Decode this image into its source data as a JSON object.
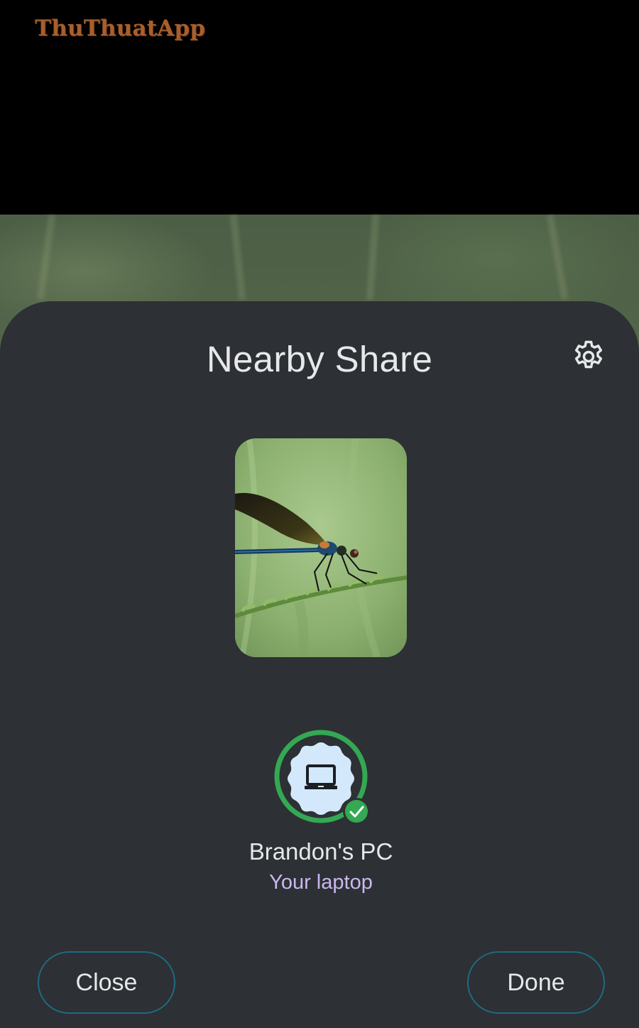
{
  "watermark": {
    "text": "ThuThuatApp"
  },
  "sheet": {
    "title": "Nearby Share",
    "settings_icon": "gear-icon"
  },
  "preview": {
    "image": "dragonfly-on-grass-photo"
  },
  "device": {
    "icon": "laptop-icon",
    "status_icon": "check-icon",
    "name": "Brandon's PC",
    "subtitle": "Your laptop"
  },
  "actions": {
    "close_label": "Close",
    "done_label": "Done"
  },
  "colors": {
    "sheet_bg": "#2d3034",
    "button_border": "#1f6a82",
    "success_green": "#34a853",
    "avatar_fill": "#d3e9fb",
    "subtitle_purple": "#c9b8f0",
    "watermark_brown": "#a85f2c"
  }
}
